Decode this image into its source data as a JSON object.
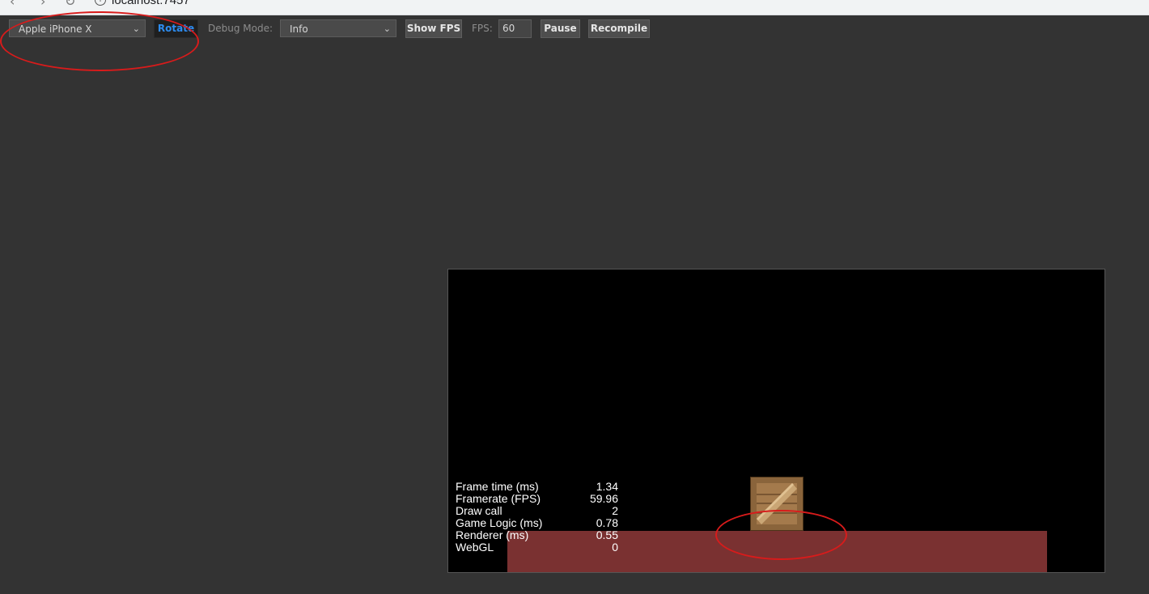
{
  "browser": {
    "url": "localhost:7457"
  },
  "toolbar": {
    "device_select": {
      "value": "Apple iPhone X"
    },
    "rotate_label": "Rotate",
    "debug_mode_label": "Debug Mode:",
    "debug_select": {
      "value": "Info"
    },
    "show_fps_label": "Show FPS",
    "fps_label": "FPS:",
    "fps_value": "60",
    "pause_label": "Pause",
    "recompile_label": "Recompile"
  },
  "stats": [
    {
      "label": "Frame time (ms)",
      "value": "1.34"
    },
    {
      "label": "Framerate (FPS)",
      "value": "59.96"
    },
    {
      "label": "Draw call",
      "value": "2"
    },
    {
      "label": "Game Logic (ms)",
      "value": "0.78"
    },
    {
      "label": "Renderer (ms)",
      "value": "0.55"
    },
    {
      "label": "WebGL",
      "value": "0"
    }
  ],
  "colors": {
    "background": "#333333",
    "canvas": "#000000",
    "ground": "#7a3131",
    "annotation": "#d81b1b",
    "rotate_text": "#2d8cf0"
  }
}
